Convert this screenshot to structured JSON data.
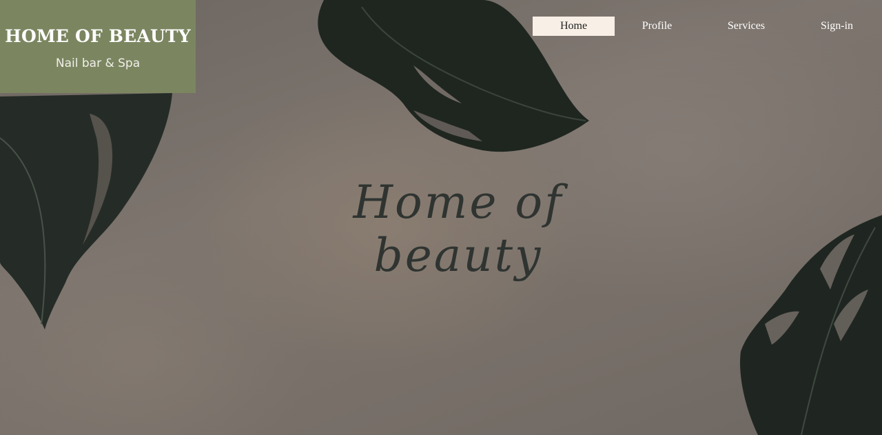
{
  "brand": {
    "title": "HOME OF BEAUTY",
    "subtitle": "Nail bar & Spa"
  },
  "nav": {
    "items": [
      {
        "label": "Home",
        "active": true
      },
      {
        "label": "Profile",
        "active": false
      },
      {
        "label": "Services",
        "active": false
      },
      {
        "label": "Sign-in",
        "active": false
      }
    ]
  },
  "hero": {
    "title": "Home of beauty"
  },
  "colors": {
    "brand_box": "#7b8661",
    "nav_active_bg": "#f8efe6",
    "leaf": "#262d28",
    "background": "#7a726b"
  },
  "decor": {
    "background_icon": "sand-texture-background",
    "leaf_icon": "monstera-leaf-icon"
  }
}
